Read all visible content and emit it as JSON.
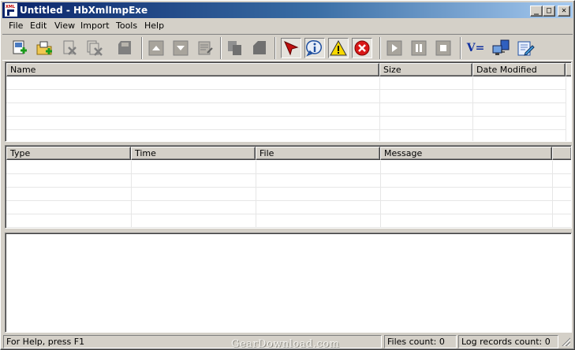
{
  "window": {
    "title": "Untitled - HbXmlImpExe",
    "app_icon_label": "XML",
    "caption_buttons": {
      "minimize": "_",
      "maximize": "□",
      "close": "✕"
    }
  },
  "menu": [
    "File",
    "Edit",
    "View",
    "Import",
    "Tools",
    "Help"
  ],
  "toolbar": {
    "buttons": [
      {
        "name": "new-file-icon"
      },
      {
        "name": "add-folder-icon"
      },
      {
        "name": "remove-file-icon"
      },
      {
        "name": "remove-all-icon"
      },
      {
        "name": "save-icon"
      },
      {
        "name": "move-up-icon"
      },
      {
        "name": "move-down-icon"
      },
      {
        "name": "properties-icon"
      },
      {
        "name": "copy-icon"
      },
      {
        "name": "paste-icon"
      },
      {
        "name": "pointer-icon"
      },
      {
        "name": "info-icon"
      },
      {
        "name": "warning-icon"
      },
      {
        "name": "error-icon"
      },
      {
        "name": "play-icon"
      },
      {
        "name": "pause-icon"
      },
      {
        "name": "stop-icon"
      },
      {
        "name": "variables-icon",
        "label": "V="
      },
      {
        "name": "connection-icon"
      },
      {
        "name": "edit-settings-icon"
      }
    ]
  },
  "files_list": {
    "columns": [
      "Name",
      "Size",
      "Date Modified"
    ]
  },
  "log_list": {
    "columns": [
      "Type",
      "Time",
      "File",
      "Message"
    ]
  },
  "status": {
    "help": "For Help, press F1",
    "files_count": "Files count: 0",
    "log_count": "Log records count: 0"
  },
  "watermark": "GearDownload.com",
  "colors": {
    "title_gradient_start": "#0a246a",
    "title_gradient_end": "#a6caf0",
    "face": "#d4d0c8"
  }
}
